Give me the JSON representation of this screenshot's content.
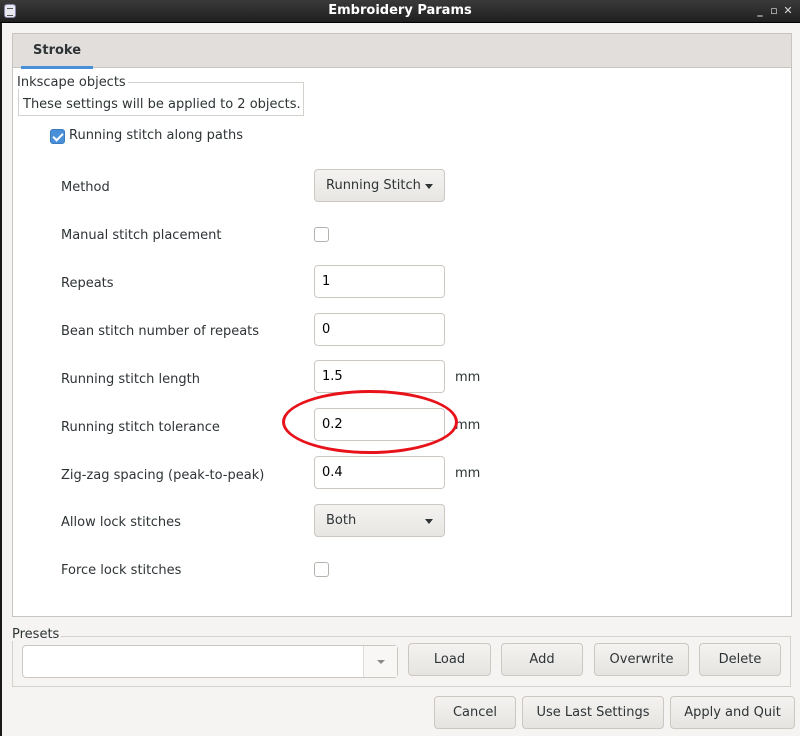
{
  "window": {
    "title": "Embroidery Params",
    "controls": {
      "minimize": "_",
      "maximize": "▫",
      "close": "✕"
    }
  },
  "tabs": [
    {
      "label": "Stroke",
      "active": true
    }
  ],
  "inkscape_objects": {
    "legend": "Inkscape objects",
    "text": "These settings will be applied to 2 objects."
  },
  "enable": {
    "label": "Running stitch along paths",
    "checked": true
  },
  "params": [
    {
      "label": "Method",
      "type": "dropdown",
      "value": "Running Stitch"
    },
    {
      "label": "Manual stitch placement",
      "type": "checkbox",
      "checked": false
    },
    {
      "label": "Repeats",
      "type": "entry",
      "value": "1"
    },
    {
      "label": "Bean stitch number of repeats",
      "type": "entry",
      "value": "0"
    },
    {
      "label": "Running stitch length",
      "type": "entry",
      "value": "1.5",
      "unit": "mm"
    },
    {
      "label": "Running stitch tolerance",
      "type": "entry",
      "value": "0.2",
      "unit": "mm",
      "highlighted": true
    },
    {
      "label": "Zig-zag spacing (peak-to-peak)",
      "type": "entry",
      "value": "0.4",
      "unit": "mm"
    },
    {
      "label": "Allow lock stitches",
      "type": "dropdown",
      "value": "Both"
    },
    {
      "label": "Force lock stitches",
      "type": "checkbox",
      "checked": false
    }
  ],
  "presets": {
    "legend": "Presets",
    "value": "",
    "buttons": {
      "load": "Load",
      "add": "Add",
      "overwrite": "Overwrite",
      "delete": "Delete"
    }
  },
  "footer": {
    "cancel": "Cancel",
    "use_last": "Use Last Settings",
    "apply": "Apply and Quit"
  },
  "colors": {
    "accent": "#4a90d9",
    "highlight_ring": "#e8131a"
  }
}
